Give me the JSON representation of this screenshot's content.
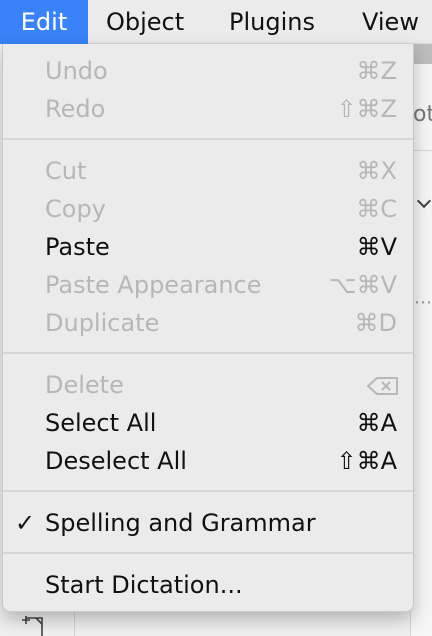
{
  "menubar": {
    "items": [
      {
        "label": "Edit",
        "active": true
      },
      {
        "label": "Object",
        "active": false
      },
      {
        "label": "Plugins",
        "active": false
      },
      {
        "label": "View",
        "active": false
      }
    ]
  },
  "background": {
    "fragment_text": "ot"
  },
  "menu": {
    "items": [
      {
        "label": "Undo",
        "shortcut": "⌘Z",
        "enabled": false
      },
      {
        "label": "Redo",
        "shortcut": "⇧⌘Z",
        "enabled": false
      },
      {
        "label": "Cut",
        "shortcut": "⌘X",
        "enabled": false
      },
      {
        "label": "Copy",
        "shortcut": "⌘C",
        "enabled": false
      },
      {
        "label": "Paste",
        "shortcut": "⌘V",
        "enabled": true
      },
      {
        "label": "Paste Appearance",
        "shortcut": "⌥⌘V",
        "enabled": false
      },
      {
        "label": "Duplicate",
        "shortcut": "⌘D",
        "enabled": false
      },
      {
        "label": "Delete",
        "shortcut_icon": "delete-key-icon",
        "enabled": false
      },
      {
        "label": "Select All",
        "shortcut": "⌘A",
        "enabled": true
      },
      {
        "label": "Deselect All",
        "shortcut": "⇧⌘A",
        "enabled": true
      },
      {
        "label": "Spelling and Grammar",
        "checked": true,
        "check_glyph": "✓",
        "enabled": true
      },
      {
        "label": "Start Dictation...",
        "enabled": true
      }
    ]
  },
  "colors": {
    "accent": "#3a82f7",
    "disabled_text": "#b7b7b7",
    "enabled_text": "#111111"
  }
}
